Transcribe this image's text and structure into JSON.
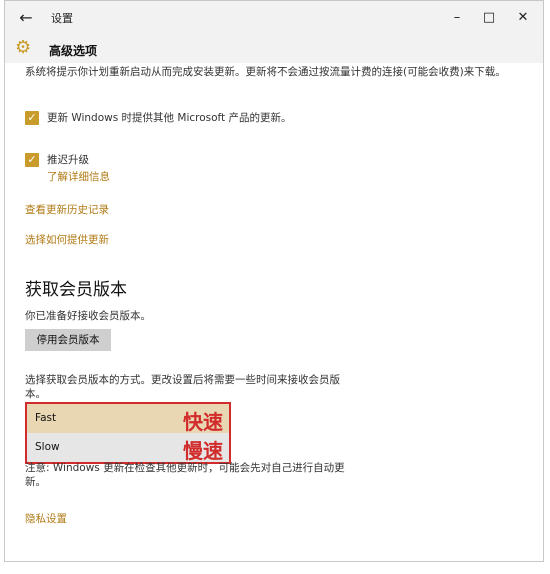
{
  "window": {
    "back_icon": "←",
    "title": "设置",
    "minimize_icon": "–",
    "maximize_icon": "□",
    "close_icon": "✕"
  },
  "header": {
    "gear_icon": "⚙",
    "title": "高级选项"
  },
  "content": {
    "cut_text": "系统将提示你计划重新启动从而完成安装更新。更新将不会通过按流量计费的连接(可能会收费)来下载。",
    "checkbox_other_products": "更新 Windows 时提供其他 Microsoft 产品的更新。",
    "checkbox_defer": "推迟升级",
    "learn_more_link": "了解详细信息",
    "history_link": "查看更新历史记录",
    "delivery_link": "选择如何提供更新",
    "insider_title": "获取会员版本",
    "insider_ready_text": "你已准备好接收会员版本。",
    "stop_insider_button": "停用会员版本",
    "insider_desc": "选择获取会员版本的方式。更改设置后将需要一些时间来接收会员版本。",
    "options": [
      {
        "label": "Fast",
        "annotation": "快速"
      },
      {
        "label": "Slow",
        "annotation": "慢速"
      }
    ],
    "note_text": "注意: Windows 更新在检查其他更新时，可能会先对自己进行自动更新。",
    "privacy_link": "隐私设置"
  },
  "colors": {
    "accent": "#c89b2a",
    "link": "#b07a14",
    "annotation_red": "#d12b2b",
    "fast_selected_bg": "#e9d6b3"
  }
}
